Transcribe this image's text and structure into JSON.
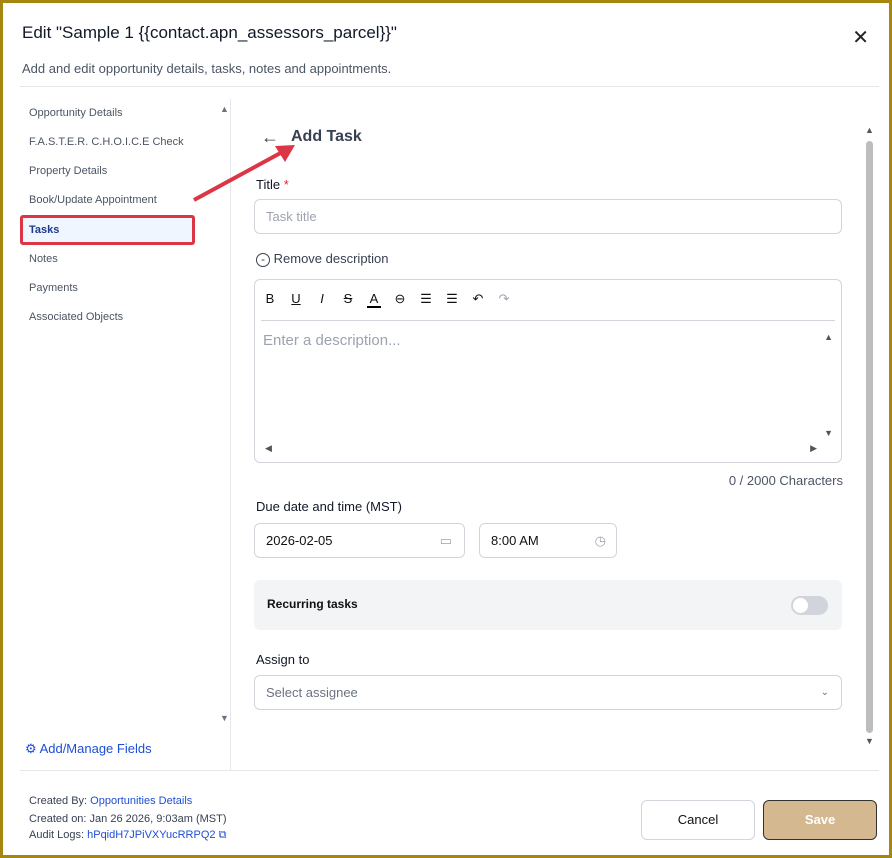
{
  "header": {
    "title": "Edit \"Sample 1 {{contact.apn_assessors_parcel}}\"",
    "subtitle": "Add and edit opportunity details, tasks, notes and appointments.",
    "close": "✕"
  },
  "sidebar": {
    "items": [
      {
        "label": "Opportunity Details"
      },
      {
        "label": "F.A.S.T.E.R. C.H.O.I.C.E Check"
      },
      {
        "label": "Property Details"
      },
      {
        "label": "Book/Update Appointment"
      },
      {
        "label": "Tasks",
        "active": true
      },
      {
        "label": "Notes"
      },
      {
        "label": "Payments"
      },
      {
        "label": "Associated Objects"
      }
    ],
    "add_fields": "Add/Manage Fields"
  },
  "task": {
    "heading": "Add Task",
    "title_label": "Title",
    "required": "*",
    "title_placeholder": "Task title",
    "remove_description": "Remove description",
    "description_placeholder": "Enter a description...",
    "char_count": "0 / 2000 Characters",
    "due_label": "Due date and time (MST)",
    "date": "2026-02-05",
    "time": "8:00 AM",
    "recurring": "Recurring tasks",
    "recurring_on": false,
    "assign_label": "Assign to",
    "assign_placeholder": "Select assignee"
  },
  "footer": {
    "created_by_label": "Created By:",
    "created_by": "Opportunities Details",
    "created_on": "Created on: Jan 26 2026, 9:03am (MST)",
    "audit_label": "Audit Logs:",
    "audit_id": "hPqidH7JPiVXYucRRPQ2",
    "cancel": "Cancel",
    "save": "Save"
  },
  "colors": {
    "accent": "#1d4ed8",
    "save": "#d4b88f",
    "highlight": "#dc3545"
  }
}
